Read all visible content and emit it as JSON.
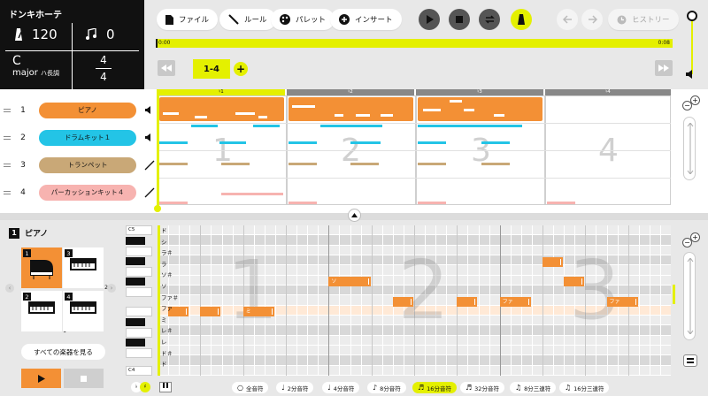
{
  "app": {
    "title": "ドンキホーテ"
  },
  "info": {
    "tempo": "120",
    "beat_shift": "0",
    "key_note": "C",
    "key_mode": "major",
    "key_scale": "ハ長調",
    "time_top": "4",
    "time_bottom": "4"
  },
  "toolbar": {
    "file": "ファイル",
    "rule": "ルール",
    "palette": "パレット",
    "insert": "インサート",
    "history": "ヒストリー"
  },
  "timeline": {
    "start": "0:00",
    "end": "0:08",
    "range": "1-4",
    "add": "+"
  },
  "bars": [
    "1",
    "2",
    "3",
    "4"
  ],
  "tracks": [
    {
      "num": "1",
      "name": "ピアノ",
      "color": "#f39035",
      "icon": "speaker-icon"
    },
    {
      "num": "2",
      "name": "ドラムキット１",
      "color": "#23c4e6",
      "icon": "speaker-icon"
    },
    {
      "num": "3",
      "name": "トランペット",
      "color": "#c9a877",
      "icon": "slash-icon"
    },
    {
      "num": "4",
      "name": "パーカッションキット４",
      "color": "#f7b3b0",
      "icon": "slash-icon"
    }
  ],
  "panel": {
    "num": "1",
    "name": "ピアノ",
    "tiles": [
      {
        "n": "1",
        "icon": "grand-piano-icon",
        "count": ""
      },
      {
        "n": "3",
        "icon": "keyboard-icon",
        "count": "2"
      },
      {
        "n": "2",
        "icon": "keyboard-icon",
        "count": "1"
      },
      {
        "n": "4",
        "icon": "keyboard-icon",
        "count": ""
      }
    ],
    "see_all": "すべての楽器を見る"
  },
  "keys": {
    "top": "C5",
    "bottom": "C4"
  },
  "note_names": [
    "ド",
    "シ",
    "ラ＃",
    "ラ",
    "ソ＃",
    "ソ",
    "ファ＃",
    "ファ",
    "ミ",
    "レ＃",
    "レ",
    "ド＃",
    "ド"
  ],
  "roll_notes": [
    {
      "label": "",
      "row": 8,
      "start": 4,
      "len": 2
    },
    {
      "label": "",
      "row": 8,
      "start": 1,
      "len": 2
    },
    {
      "label": "ミ",
      "row": 8,
      "start": 8,
      "len": 3
    },
    {
      "label": "ソ",
      "row": 5,
      "start": 16,
      "len": 4
    },
    {
      "label": "",
      "row": 7,
      "start": 22,
      "len": 2
    },
    {
      "label": "",
      "row": 7,
      "start": 28,
      "len": 2
    },
    {
      "label": "ファ",
      "row": 7,
      "start": 32,
      "len": 3
    },
    {
      "label": "",
      "row": 3,
      "start": 36,
      "len": 2
    },
    {
      "label": "",
      "row": 5,
      "start": 38,
      "len": 2
    },
    {
      "label": "ファ",
      "row": 7,
      "start": 42,
      "len": 3
    }
  ],
  "lengths": [
    {
      "label": "全音符",
      "icon": "○",
      "active": false
    },
    {
      "label": "2分音符",
      "icon": "♩",
      "active": false
    },
    {
      "label": "4分音符",
      "icon": "♩",
      "active": false
    },
    {
      "label": "8分音符",
      "icon": "♪",
      "active": false
    },
    {
      "label": "16分音符",
      "icon": "♬",
      "active": true
    },
    {
      "label": "32分音符",
      "icon": "♬",
      "active": false
    },
    {
      "label": "8分三連符",
      "icon": "♫",
      "active": false
    },
    {
      "label": "16分三連符",
      "icon": "♫",
      "active": false
    }
  ],
  "colors": {
    "accent": "#e4f000",
    "orange": "#f39035",
    "cyan": "#23c4e6",
    "tan": "#c9a877",
    "pink": "#f7b3b0"
  }
}
